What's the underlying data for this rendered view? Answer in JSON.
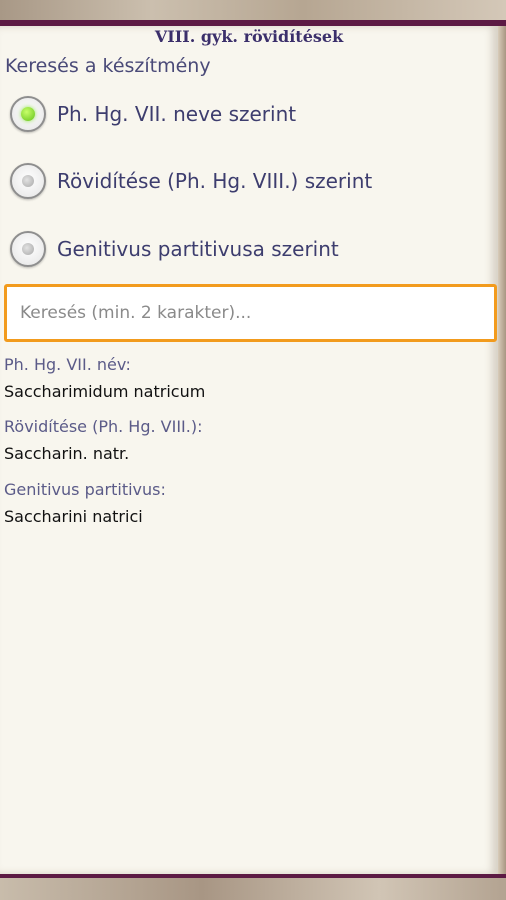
{
  "header": {
    "title": "VIII. gyk. rövidítések"
  },
  "search_by": {
    "label": "Keresés a készítmény",
    "options": [
      {
        "label": "Ph. Hg. VII. neve szerint",
        "selected": true
      },
      {
        "label": "Rövidítése (Ph. Hg. VIII.) szerint",
        "selected": false
      },
      {
        "label": "Genitivus partitivusa szerint",
        "selected": false
      }
    ]
  },
  "search": {
    "placeholder": "Keresés (min. 2 karakter)...",
    "value": ""
  },
  "result": {
    "name_label": "Ph. Hg. VII. név:",
    "name_value": "Saccharimidum natricum",
    "abbr_label": "Rövidítése (Ph. Hg. VIII.):",
    "abbr_value": "Saccharin. natr.",
    "genitive_label": "Genitivus partitivus:",
    "genitive_value": "Saccharini natrici"
  },
  "colors": {
    "accent_bar": "#5c1a44",
    "search_border": "#f29b1d",
    "radio_selected": "#63c21a"
  }
}
